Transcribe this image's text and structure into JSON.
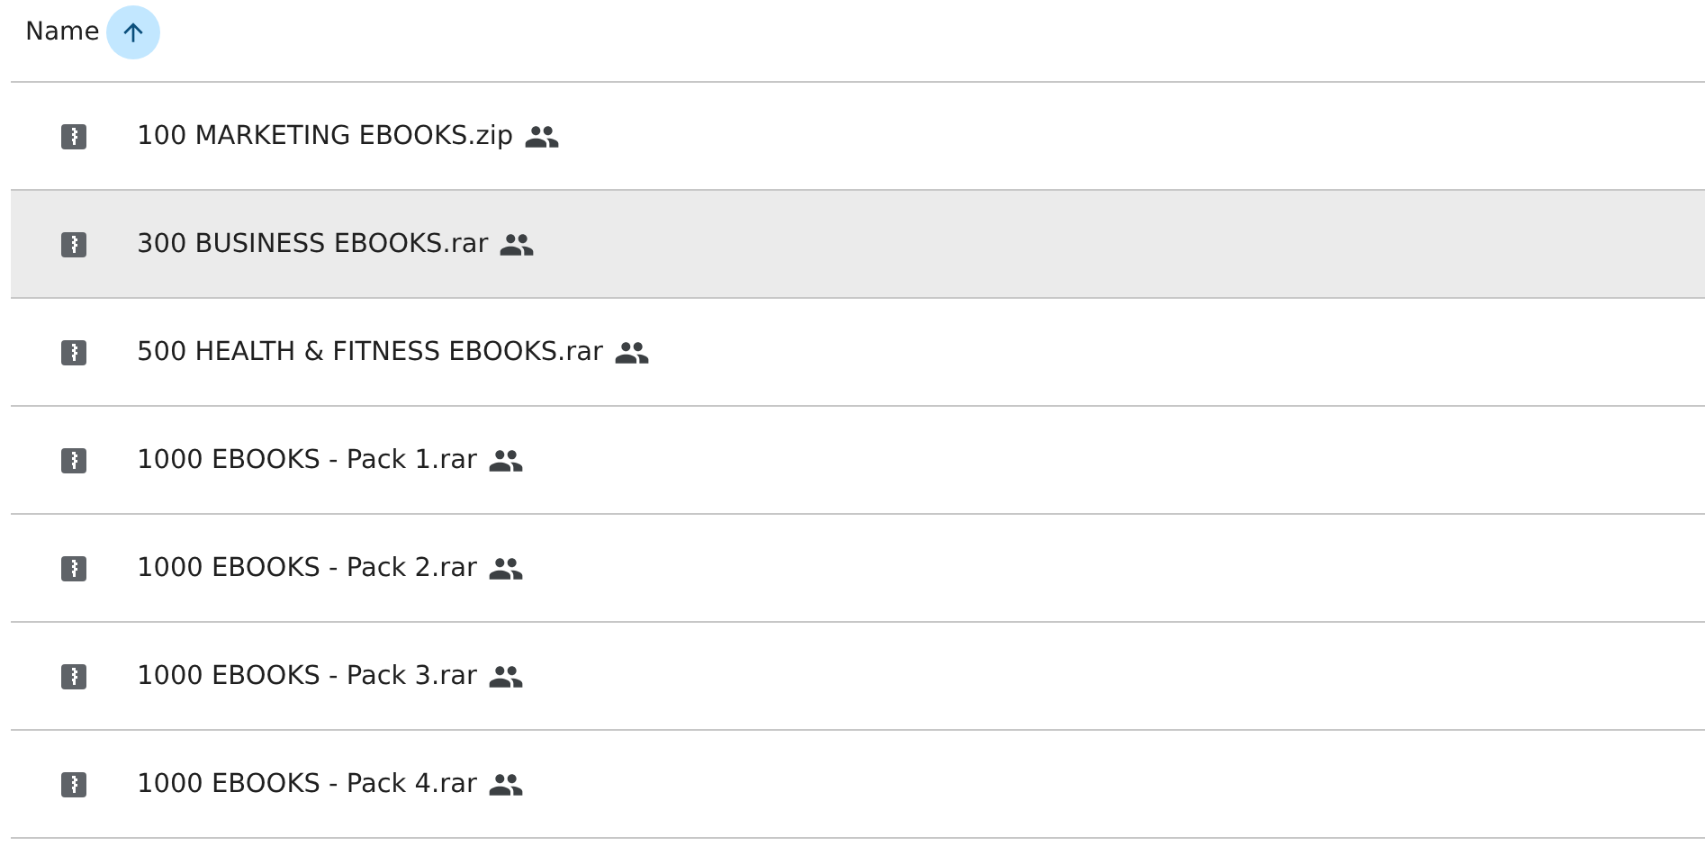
{
  "header": {
    "label": "Name",
    "sort_ascending": true
  },
  "files": [
    {
      "name": "100 MARKETING EBOOKS.zip",
      "shared": true,
      "selected": false
    },
    {
      "name": "300 BUSINESS EBOOKS.rar",
      "shared": true,
      "selected": true
    },
    {
      "name": "500 HEALTH & FITNESS EBOOKS.rar",
      "shared": true,
      "selected": false
    },
    {
      "name": "1000 EBOOKS - Pack 1.rar",
      "shared": true,
      "selected": false
    },
    {
      "name": "1000 EBOOKS - Pack 2.rar",
      "shared": true,
      "selected": false
    },
    {
      "name": "1000 EBOOKS - Pack 3.rar",
      "shared": true,
      "selected": false
    },
    {
      "name": "1000 EBOOKS - Pack 4.rar",
      "shared": true,
      "selected": false
    }
  ]
}
